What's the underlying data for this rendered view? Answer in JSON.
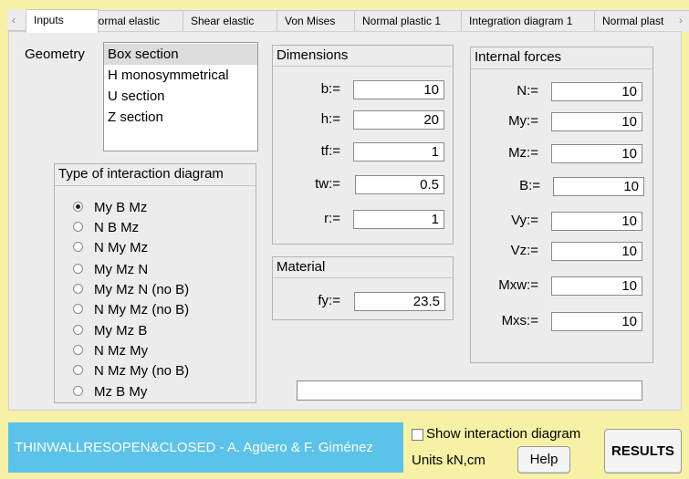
{
  "tabs": [
    {
      "label": "Inputs",
      "active": true
    },
    {
      "label": "Normal elastic"
    },
    {
      "label": "Shear elastic"
    },
    {
      "label": "Von Mises"
    },
    {
      "label": "Normal plastic 1"
    },
    {
      "label": "Integration diagram 1"
    },
    {
      "label": "Normal plast"
    }
  ],
  "tab_nav": {
    "prev": "‹",
    "next": "›"
  },
  "geometry": {
    "label": "Geometry",
    "options": [
      "Box section",
      "H monosymmetrical",
      "U section",
      "Z section"
    ],
    "selected": "Box section"
  },
  "interaction": {
    "title": "Type of interaction diagram",
    "options": [
      "My B Mz",
      "N B Mz",
      "N My Mz",
      "My Mz N",
      "My Mz N (no B)",
      "N My Mz (no B)",
      "My Mz B",
      "N Mz My",
      "N Mz My (no B)",
      "Mz B My"
    ],
    "selected": "My B Mz"
  },
  "dimensions": {
    "title": "Dimensions",
    "fields": [
      {
        "label": "b:=",
        "value": "10"
      },
      {
        "label": "h:=",
        "value": "20"
      },
      {
        "label": "tf:=",
        "value": "1"
      },
      {
        "label": "tw:=",
        "value": "0.5"
      },
      {
        "label": "r:=",
        "value": "1"
      }
    ]
  },
  "material": {
    "title": "Material",
    "fields": [
      {
        "label": "fy:=",
        "value": "23.5"
      }
    ]
  },
  "forces": {
    "title": "Internal forces",
    "fields": [
      {
        "label": "N:=",
        "value": "10"
      },
      {
        "label": "My:=",
        "value": "10"
      },
      {
        "label": "Mz:=",
        "value": "10"
      },
      {
        "label": "B:=",
        "value": "10"
      },
      {
        "label": "Vy:=",
        "value": "10"
      },
      {
        "label": "Vz:=",
        "value": "10"
      },
      {
        "label": "Mxw:=",
        "value": "10"
      },
      {
        "label": "Mxs:=",
        "value": "10"
      }
    ]
  },
  "status": {
    "text": ""
  },
  "footer": {
    "banner": "THINWALLRESOPEN&CLOSED - A. Agüero & F. Giménez",
    "show_diagram": "Show interaction diagram",
    "units": "Units kN,cm",
    "help": "Help",
    "results": "RESULTS"
  },
  "colors": {
    "background": "#f6f1a4",
    "banner": "#5bc2ea",
    "panel": "#ececec"
  }
}
